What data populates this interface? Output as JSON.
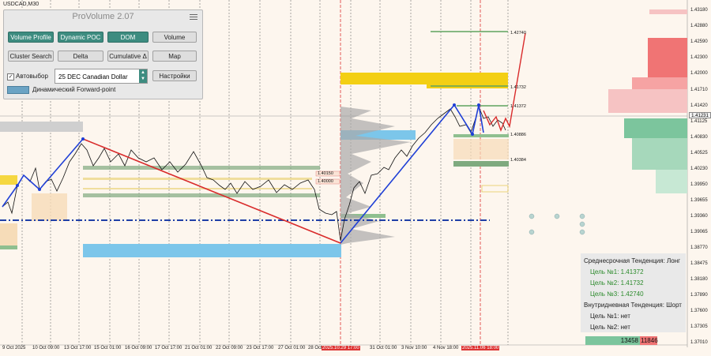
{
  "symbol": "USDCAD,M30",
  "panel": {
    "title": "ProVolume 2.07",
    "buttons": {
      "volume_profile": "Volume Profile",
      "dynamic_poc": "Dynamic POC",
      "dom": "DOM",
      "volume": "Volume",
      "cluster_search": "Cluster Search",
      "delta": "Delta",
      "cumulative_delta": "Cumulative Δ",
      "map": "Map",
      "settings": "Настройки"
    },
    "autoselect_label": "Автовыбор",
    "autoselect_checked": true,
    "contract": "25 DEC Canadian Dollar",
    "forward_label": "Динамический Forward-point",
    "active_color": "#3d8c80"
  },
  "trend_box": {
    "mid_title": "Среднесрочная Тенденция: Лонг",
    "target1": "Цель №1: 1.41372",
    "target2": "Цель №2: 1.41732",
    "target3": "Цель №3: 1.42740",
    "intraday_title": "Внутридневная Тенденция: Шорт",
    "intraday1": "Цель №1: нет",
    "intraday2": "Цель №2: нет"
  },
  "volume_bar": {
    "buy": "13458",
    "sell": "11846"
  },
  "current_price": "1.41231",
  "level_labels": {
    "l1": "1.42740",
    "l2": "1.41732",
    "l3": "1.41372",
    "l4": "1.40886",
    "l5": "1.40384",
    "l6": "1.40150",
    "l7": "1.40000"
  },
  "y_axis": [
    "1.43180",
    "1.42880",
    "1.42590",
    "1.42300",
    "1.42000",
    "1.41710",
    "1.41420",
    "1.41125",
    "1.40830",
    "1.40525",
    "1.40230",
    "1.39950",
    "1.39655",
    "1.39360",
    "1.39065",
    "1.38770",
    "1.38475",
    "1.38180",
    "1.37890",
    "1.37600",
    "1.37305",
    "1.37010"
  ],
  "x_axis": [
    "9 Oct 2025",
    "10 Oct 09:00",
    "13 Oct 17:00",
    "15 Oct 01:00",
    "16 Oct 09:00",
    "17 Oct 17:00",
    "21 Oct 01:00",
    "22 Oct 09:00",
    "23 Oct 17:00",
    "27 Oct 01:00",
    "28 Oct",
    "2025.10.29 17:00",
    "31 Oct 01:00",
    "3 Nov 10:00",
    "4 Nov 18:00",
    "2025.11.06 18:00"
  ],
  "colors": {
    "up_trend": "#1f3fd6",
    "down_trend": "#d92b2b",
    "buy_profile": "#7cc59d",
    "sell_profile": "#f07474",
    "gold_zone": "#f3cf14",
    "blue_zone": "#7cc6ea",
    "green_zone": "#5fa35f"
  }
}
